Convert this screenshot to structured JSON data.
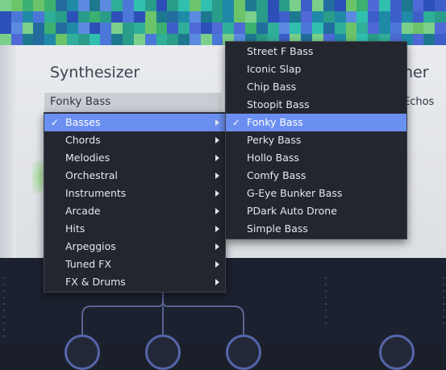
{
  "panel": {
    "title": "Synthesizer",
    "title_right_partial": "her",
    "preset_value": "Fonky Bass",
    "right_label_partial": "Echos"
  },
  "category_menu": {
    "items": [
      {
        "label": "Basses",
        "checked": true,
        "has_submenu": true
      },
      {
        "label": "Chords",
        "checked": false,
        "has_submenu": true
      },
      {
        "label": "Melodies",
        "checked": false,
        "has_submenu": true
      },
      {
        "label": "Orchestral",
        "checked": false,
        "has_submenu": true
      },
      {
        "label": "Instruments",
        "checked": false,
        "has_submenu": true
      },
      {
        "label": "Arcade",
        "checked": false,
        "has_submenu": true
      },
      {
        "label": "Hits",
        "checked": false,
        "has_submenu": true
      },
      {
        "label": "Arpeggios",
        "checked": false,
        "has_submenu": true
      },
      {
        "label": "Tuned FX",
        "checked": false,
        "has_submenu": true
      },
      {
        "label": "FX & Drums",
        "checked": false,
        "has_submenu": true
      }
    ]
  },
  "preset_submenu": {
    "items": [
      {
        "label": "Street F Bass",
        "checked": false
      },
      {
        "label": "Iconic Slap",
        "checked": false
      },
      {
        "label": "Chip Bass",
        "checked": false
      },
      {
        "label": "Stoopit Bass",
        "checked": false
      },
      {
        "label": "Fonky Bass",
        "checked": true
      },
      {
        "label": "Perky Bass",
        "checked": false
      },
      {
        "label": "Hollo Bass",
        "checked": false
      },
      {
        "label": "Comfy Bass",
        "checked": false
      },
      {
        "label": "G-Eye Bunker Bass",
        "checked": false
      },
      {
        "label": "PDark Auto Drone",
        "checked": false
      },
      {
        "label": "Simple Bass",
        "checked": false
      }
    ]
  },
  "icons": {
    "check": "✓",
    "submenu_arrow": "chevron-right-icon"
  },
  "colors": {
    "selection": "#6b8ff0",
    "menu_bg": "#23262e",
    "panel_bg": "#e9ebef"
  }
}
